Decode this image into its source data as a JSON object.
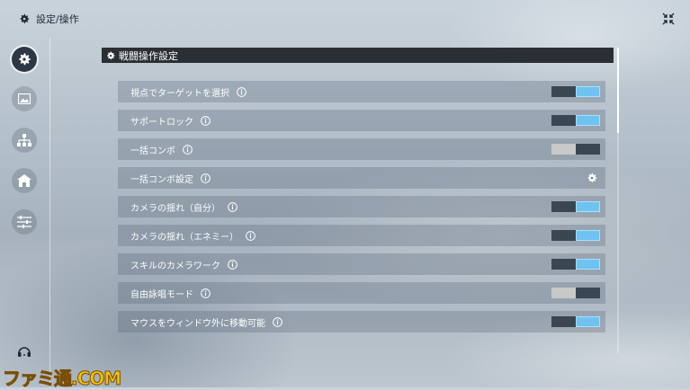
{
  "header": {
    "title": "設定/操作",
    "icon": "gear-icon",
    "close_icon": "collapse-icon"
  },
  "sidebar": {
    "items": [
      {
        "icon": "gear-icon",
        "active": true
      },
      {
        "icon": "image-icon",
        "active": false
      },
      {
        "icon": "hierarchy-icon",
        "active": false
      },
      {
        "icon": "home-icon",
        "active": false
      },
      {
        "icon": "sliders-icon",
        "active": false
      }
    ],
    "bottom_icon": "headset-icon"
  },
  "section": {
    "title": "戦闘操作設定",
    "icon": "gear-icon"
  },
  "settings": [
    {
      "label": "視点でターゲットを選択",
      "control": "toggle",
      "state": "on"
    },
    {
      "label": "サポートロック",
      "control": "toggle",
      "state": "on"
    },
    {
      "label": "一括コンボ",
      "control": "toggle",
      "state": "off"
    },
    {
      "label": "一括コンボ設定",
      "control": "gear",
      "state": ""
    },
    {
      "label": "カメラの揺れ（自分）",
      "control": "toggle",
      "state": "on"
    },
    {
      "label": "カメラの揺れ（エネミー）",
      "control": "toggle",
      "state": "on"
    },
    {
      "label": "スキルのカメラワーク",
      "control": "toggle",
      "state": "on"
    },
    {
      "label": "自由詠唱モード",
      "control": "toggle",
      "state": "off"
    },
    {
      "label": "マウスをウィンドウ外に移動可能",
      "control": "toggle",
      "state": "on"
    }
  ],
  "watermark": {
    "text": "ファミ通.COM"
  },
  "colors": {
    "toggle_on": "#6ec3f0",
    "toggle_off": "#c9c9c9",
    "header_bg": "#2b2f33"
  }
}
